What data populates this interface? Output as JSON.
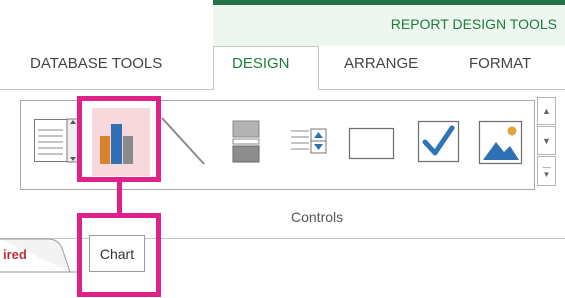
{
  "context_tab_group": {
    "label": "REPORT DESIGN TOOLS"
  },
  "tabs": [
    {
      "label": "DATABASE TOOLS",
      "active": false
    },
    {
      "label": "DESIGN",
      "active": true
    },
    {
      "label": "ARRANGE",
      "active": false
    },
    {
      "label": "FORMAT",
      "active": false
    }
  ],
  "ribbon_group": {
    "label": "Controls",
    "controls": [
      {
        "name": "text-box-icon"
      },
      {
        "name": "chart-icon",
        "highlighted": true
      },
      {
        "name": "line-icon"
      },
      {
        "name": "page-break-icon"
      },
      {
        "name": "list-box-icon"
      },
      {
        "name": "rectangle-icon"
      },
      {
        "name": "check-box-icon"
      },
      {
        "name": "image-icon"
      }
    ]
  },
  "scroll_buttons": [
    "scroll-up-icon",
    "scroll-down-icon",
    "more-icon"
  ],
  "document_tab": {
    "label": "ired"
  },
  "tooltip": {
    "label": "Chart"
  },
  "colors": {
    "accent_green": "#217346",
    "callout_magenta": "#e0218a",
    "chart_highlight": "#f7d9dd",
    "checkbox_blue": "#2e75b6"
  }
}
